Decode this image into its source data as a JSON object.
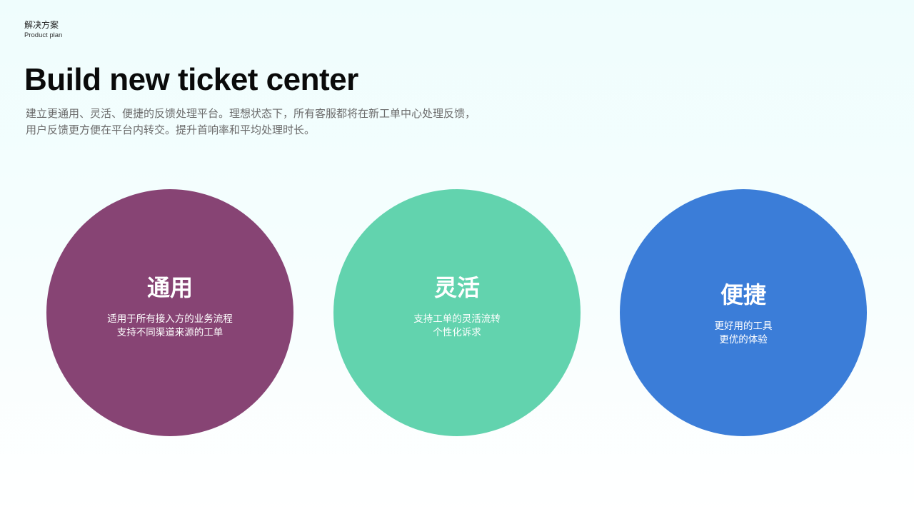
{
  "section": {
    "title": "解决方案",
    "subtitle": "Product plan"
  },
  "heading": "Build new ticket center",
  "description": {
    "line1": "建立更通用、灵活、便捷的反馈处理平台。理想状态下，所有客服都将在新工单中心处理反馈，",
    "line2": "用户反馈更方便在平台内转交。提升首响率和平均处理时长。"
  },
  "features": [
    {
      "title": "通用",
      "line1": "适用于所有接入方的业务流程",
      "line2": "支持不同渠道来源的工单",
      "color": "#874474"
    },
    {
      "title": "灵活",
      "line1": "支持工单的灵活流转",
      "line2": "个性化诉求",
      "color": "#62d3ae"
    },
    {
      "title": "便捷",
      "line1": "更好用的工具",
      "line2": "更优的体验",
      "color": "#3b7dd8"
    }
  ]
}
